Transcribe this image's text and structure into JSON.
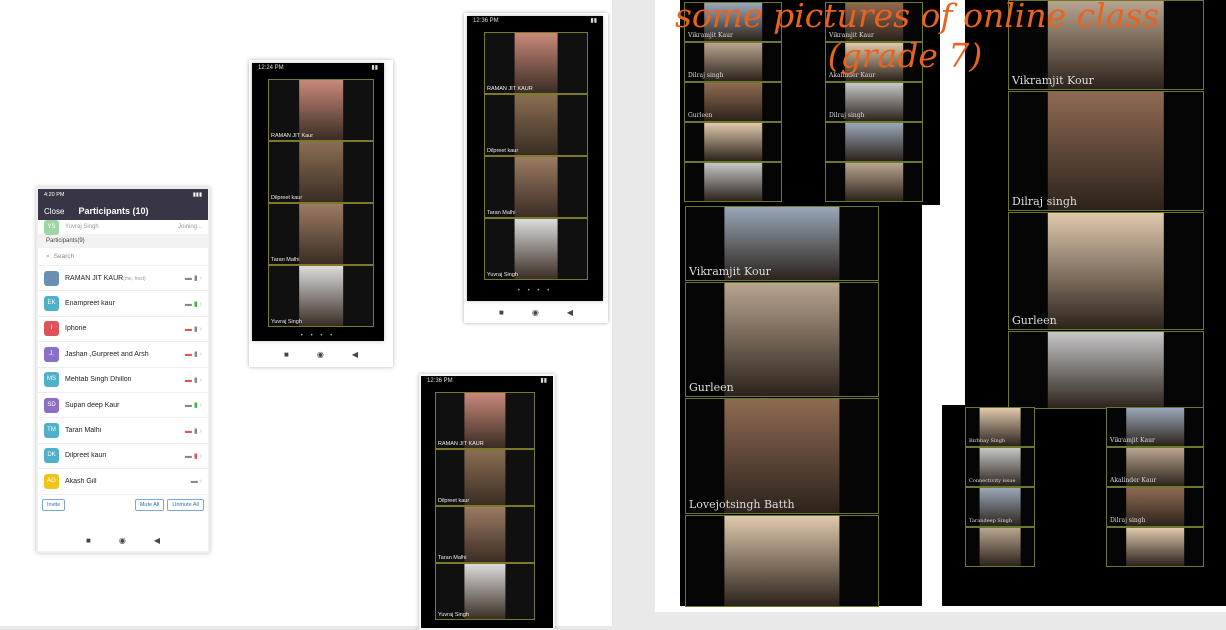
{
  "colors": {
    "accent": "#e8641e",
    "zoom_blue": "#2d6db5",
    "phone_header": "#383646",
    "tile_border": "#7a7a2a"
  },
  "headline": {
    "line1": "some pictures of online class",
    "line2": "(grade 7)"
  },
  "participants_phone": {
    "status_time": "4:20 PM",
    "close_label": "Close",
    "title": "Participants (10)",
    "joining_name": "Yuvraj Singh",
    "joining_status": "Joining...",
    "joining_initials": "YS",
    "section_label": "Participants(9)",
    "search_placeholder": "Search",
    "rows": [
      {
        "initials": "",
        "name": "RAMAN JIT KAUR",
        "suffix": "(me, host)",
        "color": "#6b8fb3",
        "video": "on",
        "mic": "on"
      },
      {
        "initials": "EK",
        "name": "Enampreet kaur",
        "suffix": "",
        "color": "#4fb0c9",
        "video": "on",
        "mic": "green"
      },
      {
        "initials": "I",
        "name": "Iphone",
        "suffix": "",
        "color": "#e0525a",
        "video": "off",
        "mic": "on"
      },
      {
        "initials": "J,",
        "name": "Jashan ,Gurpreet and Arsh",
        "suffix": "",
        "color": "#8a6ec8",
        "video": "off",
        "mic": "on"
      },
      {
        "initials": "MS",
        "name": "Mehtab Singh Dhillon",
        "suffix": "",
        "color": "#4fb0c9",
        "video": "off",
        "mic": "on"
      },
      {
        "initials": "SD",
        "name": "Supan deep Kaur",
        "suffix": "",
        "color": "#8a6ec8",
        "video": "on",
        "mic": "green"
      },
      {
        "initials": "TM",
        "name": "Taran Malhi",
        "suffix": "",
        "color": "#4fb0c9",
        "video": "off",
        "mic": "on"
      },
      {
        "initials": "DK",
        "name": "Dilpreet kauri",
        "suffix": "",
        "color": "#4fb0c9",
        "video": "on",
        "mic": "off"
      },
      {
        "initials": "AG",
        "name": "Akash Gill",
        "suffix": "",
        "color": "#f0c419",
        "video": "on",
        "mic": "none"
      }
    ],
    "invite_label": "Invite",
    "mute_all_label": "Mute All",
    "unmute_all_label": "Unmute All"
  },
  "phone2": {
    "status_time": "12:24 PM",
    "tiles": [
      "RAMAN JIT Kaur",
      "Dilpreet kaur",
      "Taran Malhi",
      "Yuvraj Singh"
    ]
  },
  "phone3": {
    "status_time": "12:36 PM",
    "tiles": [
      "RAMAN JIT KAUR",
      "Dilpreet kaur",
      "Taran Malhi",
      "Yuvraj Singh"
    ]
  },
  "phone4": {
    "status_time": "12:36 PM",
    "tiles": [
      "RAMAN JIT KAUR",
      "Dilpreet kaur",
      "Taran Malhi",
      "Yuvraj Singh"
    ]
  },
  "collage": {
    "col1_small": [
      "Vikramjit Kaur",
      "Dilraj singh",
      "Gurleen",
      "",
      ""
    ],
    "col2_small": [
      "Vikramjit Kaur",
      "Akalinder Kaur",
      "Dilraj singh",
      "",
      ""
    ],
    "col1_big": [
      "Vikramjit Kour",
      "Gurleen",
      "Lovejotsingh Batth",
      ""
    ],
    "col3_big": [
      "Vikramjit Kour",
      "Dilraj singh",
      "Gurleen",
      ""
    ],
    "bottom_left": [
      "Birbhay Singh",
      "Connectivity issue",
      "Tarandeep Singh",
      ""
    ],
    "bottom_right": [
      "Vikramjit Kaur",
      "Akalinder Kaur",
      "Dilraj singh",
      ""
    ]
  }
}
